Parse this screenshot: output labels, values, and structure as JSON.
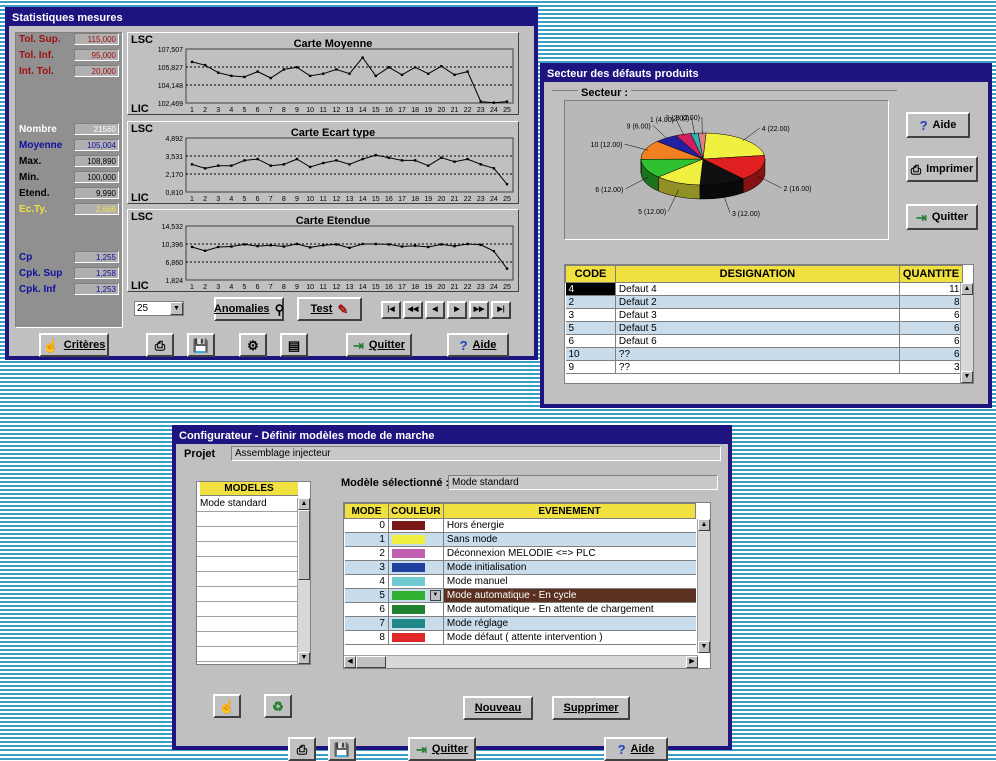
{
  "stats": {
    "title": "Statistiques mesures",
    "fields": [
      {
        "label": "Tol. Sup.",
        "value": "115,000",
        "color": "#a01010"
      },
      {
        "label": "Tol. Inf.",
        "value": "95,000",
        "color": "#a01010"
      },
      {
        "label": "Int. Tol.",
        "value": "20,000",
        "color": "#a01010"
      },
      {
        "label": "Nombre",
        "value": "21560",
        "color": "#ffffff"
      },
      {
        "label": "Moyenne",
        "value": "105,004",
        "color": "#1010a0"
      },
      {
        "label": "Max.",
        "value": "108,890",
        "color": "#000000"
      },
      {
        "label": "Min.",
        "value": "100,000",
        "color": "#000000"
      },
      {
        "label": "Etend.",
        "value": "9,990",
        "color": "#000000"
      },
      {
        "label": "Ec.Ty.",
        "value": "2,666",
        "color": "#f0e040"
      },
      {
        "label": "Cp",
        "value": "1,255",
        "color": "#1010a0"
      },
      {
        "label": "Cpk. Sup",
        "value": "1,258",
        "color": "#1010a0"
      },
      {
        "label": "Cpk. Inf",
        "value": "1,253",
        "color": "#1010a0"
      }
    ],
    "lsc": "LSC",
    "lic": "LIC",
    "charts": [
      {
        "title": "Carte Moyenne",
        "yticks": [
          "107,507",
          "105,827",
          "104,148",
          "102,469"
        ]
      },
      {
        "title": "Carte Ecart type",
        "yticks": [
          "4,892",
          "3,531",
          "2,170",
          "0,810"
        ]
      },
      {
        "title": "Carte Etendue",
        "yticks": [
          "14,532",
          "10,396",
          "6,860",
          "1,824"
        ]
      }
    ],
    "xticks": [
      "1",
      "2",
      "3",
      "4",
      "5",
      "6",
      "7",
      "8",
      "9",
      "10",
      "11",
      "12",
      "13",
      "14",
      "15",
      "16",
      "17",
      "18",
      "19",
      "20",
      "21",
      "22",
      "23",
      "24",
      "25"
    ],
    "combo": "25",
    "anomalies": "Anomalies",
    "test": "Test",
    "nav": [
      "|◀",
      "◀◀",
      "◀",
      "▶",
      "▶▶",
      "▶|"
    ],
    "criteres": "Critères",
    "quitter": "Quitter",
    "aide": "Aide"
  },
  "chart_data": [
    {
      "type": "line",
      "title": "Carte Moyenne",
      "x": [
        1,
        2,
        3,
        4,
        5,
        6,
        7,
        8,
        9,
        10,
        11,
        12,
        13,
        14,
        15,
        16,
        17,
        18,
        19,
        20,
        21,
        22,
        23,
        24,
        25
      ],
      "values": [
        106.3,
        106.0,
        105.3,
        105.0,
        104.9,
        105.4,
        104.8,
        105.6,
        105.8,
        105.0,
        105.2,
        105.6,
        105.2,
        106.7,
        105.0,
        105.8,
        105.1,
        105.8,
        105.2,
        105.9,
        105.1,
        105.4,
        102.6,
        102.5,
        102.6
      ],
      "ylim": [
        102.469,
        107.507
      ]
    },
    {
      "type": "line",
      "title": "Carte Ecart type",
      "x": [
        1,
        2,
        3,
        4,
        5,
        6,
        7,
        8,
        9,
        10,
        11,
        12,
        13,
        14,
        15,
        16,
        17,
        18,
        19,
        20,
        21,
        22,
        23,
        24,
        25
      ],
      "values": [
        2.9,
        2.6,
        2.8,
        2.8,
        3.2,
        3.3,
        2.8,
        2.9,
        3.3,
        2.7,
        3.0,
        3.2,
        2.9,
        3.3,
        3.6,
        3.4,
        3.2,
        3.2,
        2.8,
        3.4,
        3.1,
        3.3,
        2.9,
        2.6,
        1.4
      ],
      "ylim": [
        0.81,
        4.892
      ]
    },
    {
      "type": "line",
      "title": "Carte Etendue",
      "x": [
        1,
        2,
        3,
        4,
        5,
        6,
        7,
        8,
        9,
        10,
        11,
        12,
        13,
        14,
        15,
        16,
        17,
        18,
        19,
        20,
        21,
        22,
        23,
        24,
        25
      ],
      "values": [
        9.6,
        8.7,
        9.6,
        9.7,
        10.2,
        9.8,
        10.0,
        9.7,
        10.3,
        9.5,
        10.0,
        10.2,
        9.4,
        10.3,
        10.3,
        10.2,
        9.7,
        9.9,
        9.6,
        10.2,
        9.8,
        10.3,
        10.1,
        8.6,
        4.5
      ],
      "ylim": [
        1.824,
        14.532
      ]
    },
    {
      "type": "pie",
      "title": "Secteur",
      "categories": [
        "4",
        "2",
        "3",
        "5",
        "6",
        "10",
        "9",
        "1",
        "7",
        "8"
      ],
      "labels": [
        "4 (22.00)",
        "2 (16.00)",
        "3 (12.00)",
        "5 (12.00)",
        "6 (12.00)",
        "10 (12.00)",
        "9 (6.00)",
        "1 (4.00)",
        "7 (2.00)",
        "8 (2.00)"
      ],
      "values": [
        22,
        16,
        12,
        12,
        12,
        12,
        6,
        4,
        2,
        2
      ],
      "colors": [
        "#f0f040",
        "#e02020",
        "#101010",
        "#f0f040",
        "#30c030",
        "#f08020",
        "#2020a0",
        "#d02060",
        "#30b0b0",
        "#e08080"
      ]
    },
    {
      "type": "table",
      "title": "Secteur des défauts produits",
      "columns": [
        "CODE",
        "DESIGNATION",
        "QUANTITE"
      ],
      "rows": [
        [
          "4",
          "Defaut 4",
          "11"
        ],
        [
          "2",
          "Defaut 2",
          "8"
        ],
        [
          "3",
          "Defaut 3",
          "6"
        ],
        [
          "5",
          "Defaut 5",
          "6"
        ],
        [
          "6",
          "Defaut 6",
          "6"
        ],
        [
          "10",
          "??",
          "6"
        ],
        [
          "9",
          "??",
          "3"
        ]
      ]
    }
  ],
  "secteur": {
    "title": "Secteur des défauts produits",
    "group": "Secteur :",
    "aide": "Aide",
    "imprimer": "Imprimer",
    "quitter": "Quitter",
    "columns": [
      "CODE",
      "DESIGNATION",
      "QUANTITE"
    ],
    "rows": [
      {
        "code": "4",
        "des": "Defaut 4",
        "q": "11"
      },
      {
        "code": "2",
        "des": "Defaut 2",
        "q": "8"
      },
      {
        "code": "3",
        "des": "Defaut 3",
        "q": "6"
      },
      {
        "code": "5",
        "des": "Defaut 5",
        "q": "6"
      },
      {
        "code": "6",
        "des": "Defaut 6",
        "q": "6"
      },
      {
        "code": "10",
        "des": "??",
        "q": "6"
      },
      {
        "code": "9",
        "des": "??",
        "q": "3"
      }
    ]
  },
  "config": {
    "title": "Configurateur - Définir modèles mode de marche",
    "projet_label": "Projet",
    "projet_value": "Assemblage injecteur",
    "modeles_header": "MODELES",
    "modeles": [
      "Mode standard"
    ],
    "selected_label": "Modèle sélectionné :",
    "selected_value": "Mode standard",
    "columns": [
      "MODE",
      "COULEUR",
      "EVENEMENT"
    ],
    "rows": [
      {
        "mode": "0",
        "color": "#7a1818",
        "event": "Hors énergie"
      },
      {
        "mode": "1",
        "color": "#f0f040",
        "event": "Sans mode"
      },
      {
        "mode": "2",
        "color": "#c060b0",
        "event": "Déconnexion MELODIE <=> PLC"
      },
      {
        "mode": "3",
        "color": "#2040a0",
        "event": "Mode initialisation"
      },
      {
        "mode": "4",
        "color": "#70c8d0",
        "event": "Mode manuel"
      },
      {
        "mode": "5",
        "color": "#30b030",
        "event": "Mode automatique - En cycle"
      },
      {
        "mode": "6",
        "color": "#208030",
        "event": "Mode automatique - En attente de chargement"
      },
      {
        "mode": "7",
        "color": "#208888",
        "event": "Mode réglage"
      },
      {
        "mode": "8",
        "color": "#e02828",
        "event": "Mode défaut ( attente intervention )"
      }
    ],
    "nouveau": "Nouveau",
    "supprimer": "Supprimer",
    "quitter": "Quitter",
    "aide": "Aide"
  }
}
